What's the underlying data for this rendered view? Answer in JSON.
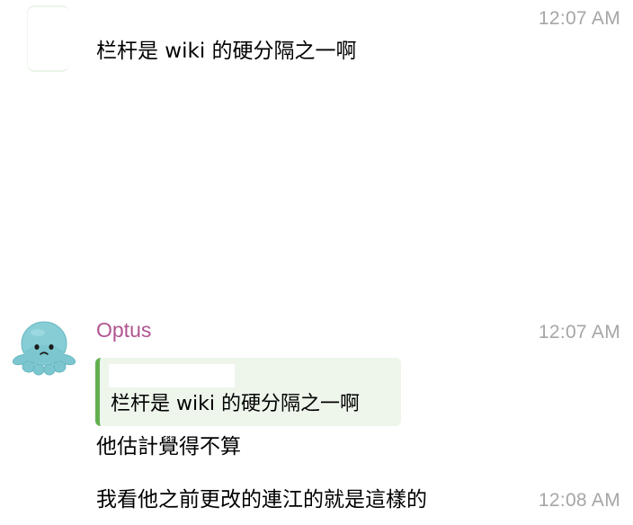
{
  "messages": [
    {
      "text": "栏杆是 wiki 的硬分隔之一啊",
      "time": "12:07 AM"
    },
    {
      "sender": "Optus",
      "time": "12:07 AM",
      "quote": {
        "sender": "",
        "text": "栏杆是 wiki 的硬分隔之一啊"
      },
      "text": "他估計覺得不算"
    },
    {
      "text": "我看他之前更改的連江的就是這樣的",
      "time": "12:08 AM"
    }
  ],
  "colors": {
    "sender": "#b0568f",
    "quote_bar": "#62b04d",
    "quote_bg": "#eef6eb",
    "timestamp": "#a6a6a6",
    "avatar": "#7cc6cf"
  },
  "icons": {
    "avatar_top": "avatar-placeholder",
    "avatar_octopus": "octopus-plush-avatar"
  }
}
